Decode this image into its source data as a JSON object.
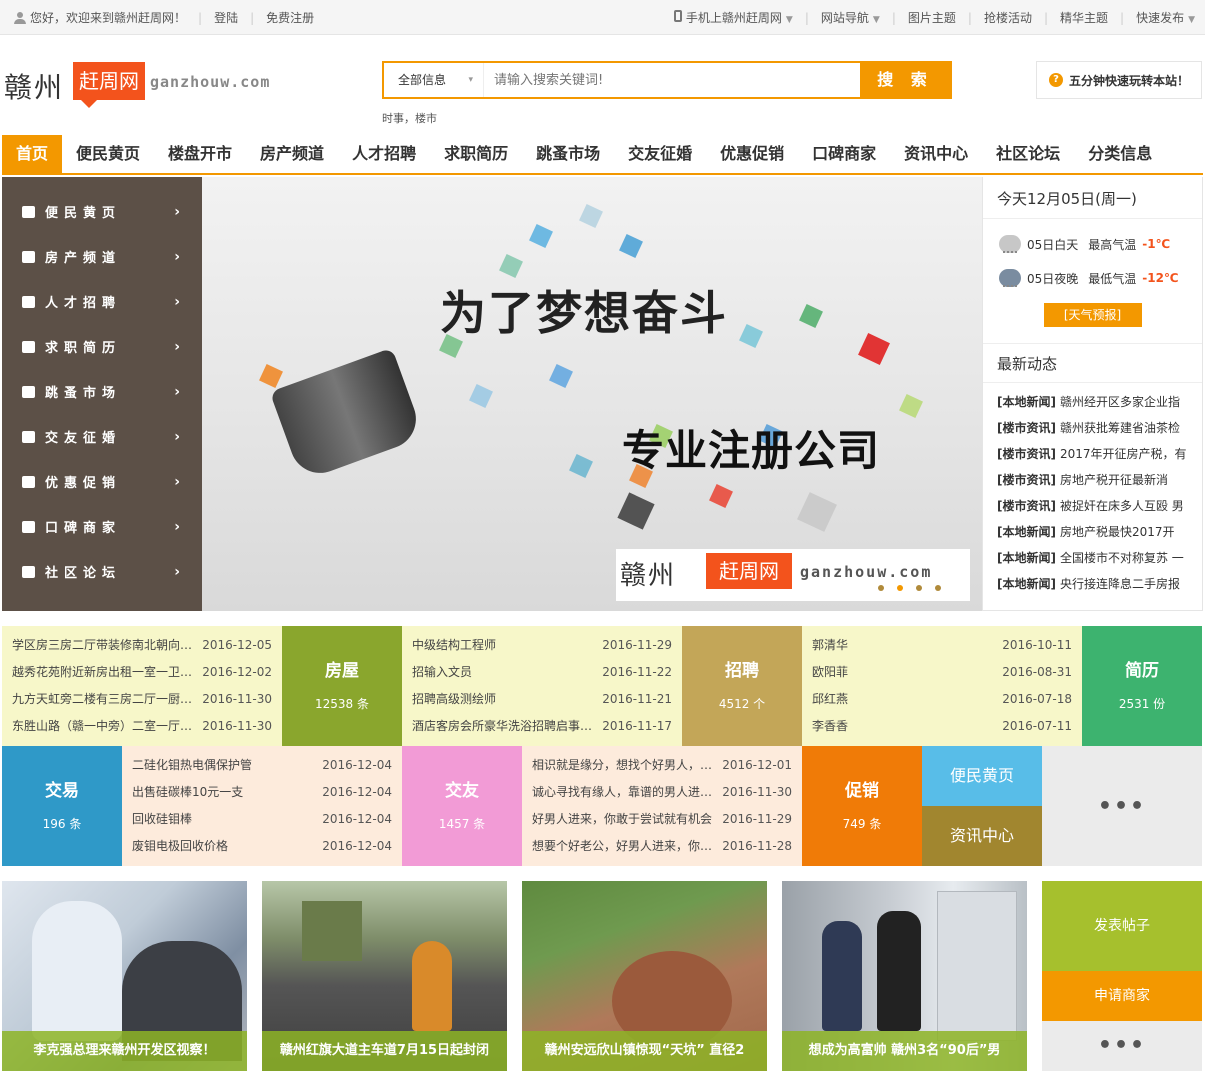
{
  "topbar": {
    "welcome": "您好，欢迎来到赣州赶周网！",
    "login": "登陆",
    "register": "免费注册",
    "links": [
      {
        "label": "手机上赣州赶周网",
        "dropdown": true,
        "icon": "phone-icon"
      },
      {
        "label": "网站导航",
        "dropdown": true
      },
      {
        "label": "图片主题",
        "dropdown": false
      },
      {
        "label": "抢楼活动",
        "dropdown": false
      },
      {
        "label": "精华主题",
        "dropdown": false
      },
      {
        "label": "快速发布",
        "dropdown": true
      }
    ]
  },
  "logo": {
    "cn": "赣州",
    "box": "赶周网",
    "en": "ganzhouw.com"
  },
  "search": {
    "category": "全部信息",
    "placeholder": "请输入搜索关键词!",
    "button": "搜 索",
    "hotwords": "时事，楼市"
  },
  "quicktip": {
    "icon": "question-icon",
    "text": "五分钟快速玩转本站！"
  },
  "nav": [
    {
      "label": "首页",
      "active": true
    },
    {
      "label": "便民黄页"
    },
    {
      "label": "楼盘开市"
    },
    {
      "label": "房产频道"
    },
    {
      "label": "人才招聘"
    },
    {
      "label": "求职简历"
    },
    {
      "label": "跳蚤市场"
    },
    {
      "label": "交友征婚"
    },
    {
      "label": "优惠促销"
    },
    {
      "label": "口碑商家"
    },
    {
      "label": "资讯中心"
    },
    {
      "label": "社区论坛"
    },
    {
      "label": "分类信息"
    }
  ],
  "sidemenu": [
    {
      "label": "便民黄页",
      "icon": "contact-icon"
    },
    {
      "label": "房产频道",
      "icon": "house-icon"
    },
    {
      "label": "人才招聘",
      "icon": "person-icon"
    },
    {
      "label": "求职简历",
      "icon": "briefcase-icon"
    },
    {
      "label": "跳蚤市场",
      "icon": "bell-icon"
    },
    {
      "label": "交友征婚",
      "icon": "puzzle-icon"
    },
    {
      "label": "优惠促销",
      "icon": "tag-icon"
    },
    {
      "label": "口碑商家",
      "icon": "shop-icon"
    },
    {
      "label": "社区论坛",
      "icon": "chat-icon"
    }
  ],
  "banner": {
    "title": "为了梦想奋斗",
    "subtitle": "专业注册公司",
    "logo_cn": "赣州",
    "logo_box": "赶周网",
    "logo_en": "ganzhouw.com",
    "active_dot": 1,
    "dot_count": 4
  },
  "weather": {
    "date": "今天12月05日(周一)",
    "day_label": "05日白天",
    "day_desc": "最高气温",
    "day_temp": "-1℃",
    "night_label": "05日夜晚",
    "night_desc": "最低气温",
    "night_temp": "-12℃",
    "forecast_button": "[天气预报]"
  },
  "news": {
    "title": "最新动态",
    "items": [
      {
        "tag": "[本地新闻]",
        "text": "赣州经开区多家企业指"
      },
      {
        "tag": "[楼市资讯]",
        "text": "赣州获批筹建省油茶检"
      },
      {
        "tag": "[楼市资讯]",
        "text": "2017年开征房产税，有"
      },
      {
        "tag": "[楼市资讯]",
        "text": "房地产税开征最新消"
      },
      {
        "tag": "[楼市资讯]",
        "text": "被捉奸在床多人互殴 男"
      },
      {
        "tag": "[本地新闻]",
        "text": "房地产税最快2017开"
      },
      {
        "tag": "[本地新闻]",
        "text": "全国楼市不对称复苏 一"
      },
      {
        "tag": "[本地新闻]",
        "text": "央行接连降息二手房报"
      }
    ]
  },
  "grid": {
    "house_list": [
      {
        "title": "学区房三房二厅带装修南北朝向免...",
        "date": "2016-12-05"
      },
      {
        "title": "越秀花苑附近新房出租一室一卫2...",
        "date": "2016-12-02"
      },
      {
        "title": "九方天虹旁二楼有三房二厅一厨二...",
        "date": "2016-11-30"
      },
      {
        "title": "东胜山路（赣一中旁）二室一厅家...",
        "date": "2016-11-30"
      }
    ],
    "house_stat": {
      "title": "房屋",
      "count": "12538 条",
      "color": "#8aa62d"
    },
    "job_list": [
      {
        "title": "中级结构工程师",
        "date": "2016-11-29"
      },
      {
        "title": "招输入文员",
        "date": "2016-11-22"
      },
      {
        "title": "招聘高级测绘师",
        "date": "2016-11-21"
      },
      {
        "title": "酒店客房会所豪华洗浴招聘启事月...",
        "date": "2016-11-17"
      }
    ],
    "job_stat": {
      "title": "招聘",
      "count": "4512 个",
      "color": "#c3a658"
    },
    "resume_list": [
      {
        "title": "郭清华",
        "date": "2016-10-11"
      },
      {
        "title": "欧阳菲",
        "date": "2016-08-31"
      },
      {
        "title": "邱红燕",
        "date": "2016-07-18"
      },
      {
        "title": "李香香",
        "date": "2016-07-11"
      }
    ],
    "resume_stat": {
      "title": "简历",
      "count": "2531 份",
      "color": "#3db36f"
    },
    "trade_stat": {
      "title": "交易",
      "count": "196 条",
      "color": "#2f99c8"
    },
    "trade_list": [
      {
        "title": "二硅化钼热电偶保护管",
        "date": "2016-12-04"
      },
      {
        "title": "出售硅碳棒10元一支",
        "date": "2016-12-04"
      },
      {
        "title": "回收硅钼棒",
        "date": "2016-12-04"
      },
      {
        "title": "废钼电极回收价格",
        "date": "2016-12-04"
      }
    ],
    "friend_stat": {
      "title": "交友",
      "count": "1457 条",
      "color": "#f29bd6"
    },
    "friend_list": [
      {
        "title": "相识就是缘分，想找个好男人，陪...",
        "date": "2016-12-01"
      },
      {
        "title": "诚心寻找有缘人，靠谱的男人进来...",
        "date": "2016-11-30"
      },
      {
        "title": "好男人进来，你敢于尝试就有机会",
        "date": "2016-11-29"
      },
      {
        "title": "想要个好老公，好男人进来，你敢...",
        "date": "2016-11-28"
      }
    ],
    "promo_stat": {
      "title": "促销",
      "count": "749 条",
      "color": "#f07b07"
    },
    "yellow_label": {
      "label": "便民黄页",
      "color": "#58bde8"
    },
    "info_label": {
      "label": "资讯中心",
      "color": "#a1862f"
    },
    "more": "•••"
  },
  "photos": [
    {
      "caption": "李克强总理来赣州开发区视察！"
    },
    {
      "caption": "赣州红旗大道主车道7月15日起封闭"
    },
    {
      "caption": "赣州安远欣山镇惊现“天坑” 直径2"
    },
    {
      "caption": "想成为高富帅 赣州3名“90后”男"
    }
  ],
  "actions": {
    "post": "发表帖子",
    "apply": "申请商家",
    "more": "•••"
  },
  "colors": {
    "accent": "#f39800",
    "logo_red": "#f3531c",
    "side_bg": "#5c5047",
    "caption_green": "#8db426"
  }
}
